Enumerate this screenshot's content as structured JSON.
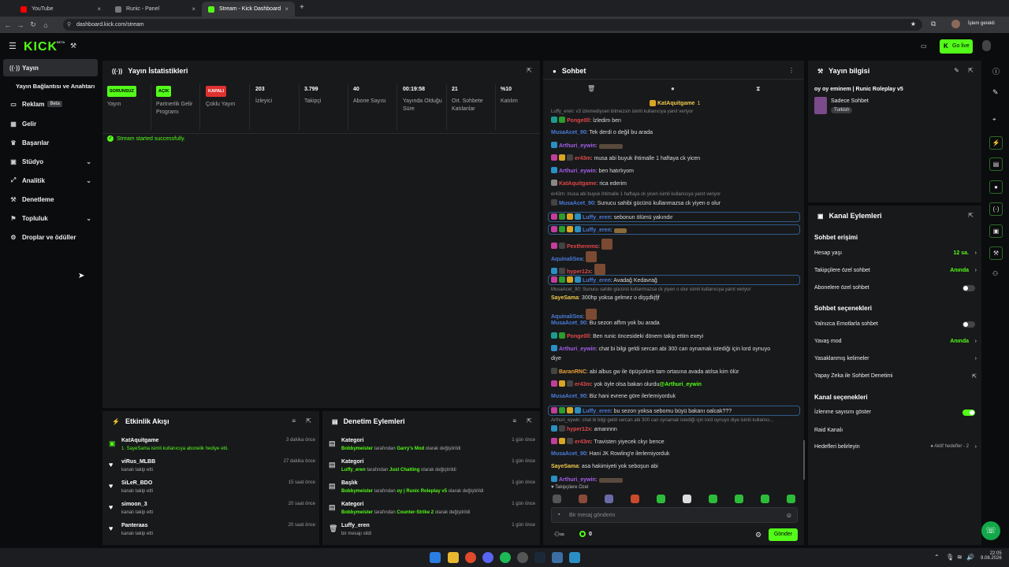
{
  "browser": {
    "tabs": [
      {
        "title": "YouTube",
        "color": "#ff0000"
      },
      {
        "title": "Runic - Panel",
        "color": "#888888"
      },
      {
        "title": "Stream - Kick Dashboard",
        "color": "#53fc18"
      }
    ],
    "new_tab": "+",
    "url": "dashboard.kick.com/stream",
    "profile_label": "İşlem gerekli"
  },
  "header": {
    "logo": "KICK",
    "logo_badge": "BETA",
    "go_live": "Go live"
  },
  "sidebar": [
    {
      "label": "Yayın",
      "icon": "((·))"
    },
    {
      "label": "Yayın Bağlantısı ve Anahtarı",
      "icon": ""
    },
    {
      "label": "Reklam",
      "icon": "▭",
      "badge": "Beta"
    },
    {
      "label": "Gelir",
      "icon": "▦"
    },
    {
      "label": "Başarılar",
      "icon": "♛"
    },
    {
      "label": "Stüdyo",
      "icon": "▣",
      "chevron": "⌄"
    },
    {
      "label": "Analitik",
      "icon": "⤢",
      "chevron": "⌄"
    },
    {
      "label": "Denetleme",
      "icon": "⚒"
    },
    {
      "label": "Topluluk",
      "icon": "⚑",
      "chevron": "⌄"
    },
    {
      "label": "Droplar ve ödüller",
      "icon": "⚙"
    }
  ],
  "stats": {
    "title": "Yayın İstatistikleri",
    "items": [
      {
        "tag": "SORUNSUZ",
        "tag_color": "#53fc18",
        "label": "Yayın"
      },
      {
        "tag": "AÇIK",
        "tag_color": "#53fc18",
        "label": "Partnerlik Gelir Programı"
      },
      {
        "tag": "KAPALI",
        "tag_color": "#e03131",
        "label": "Çoklu Yayın"
      },
      {
        "value": "203",
        "label": "İzleyici"
      },
      {
        "value": "3.799",
        "label": "Takipçi"
      },
      {
        "value": "40",
        "label": "Abone Sayısı"
      },
      {
        "value": "00:19:58",
        "label": "Yayında Olduğu Süre"
      },
      {
        "value": "21",
        "label": "Ort. Sohbete Katılanlar"
      },
      {
        "value": "%10",
        "label": "Katılım"
      }
    ],
    "success_msg": "Stream started successfully."
  },
  "activity": {
    "title": "Etkinlik Akışı",
    "items": [
      {
        "name": "KatAquitgame",
        "sub": "1. SayeSama isimli kullanıcıya abonelik hediye etti.",
        "time": "3 dakika önce",
        "icon": "▣"
      },
      {
        "name": "viRus_MLBB",
        "sub": "kanalı takip etti",
        "time": "27 dakika önce",
        "icon": "♥"
      },
      {
        "name": "SiLeR_BDO",
        "sub": "kanalı takip etti",
        "time": "15 saat önce",
        "icon": "♥"
      },
      {
        "name": "simoon_3",
        "sub": "kanalı takip etti",
        "time": "20 saat önce",
        "icon": "♥"
      },
      {
        "name": "Panteraas",
        "sub": "kanalı takip etti",
        "time": "20 saat önce",
        "icon": "♥"
      }
    ]
  },
  "moderation": {
    "title": "Denetim Eylemleri",
    "items": [
      {
        "name": "Kategori",
        "user": "Bobbymeister",
        "mid": " tarafından ",
        "obj": "Garry's Mod",
        "end": " olarak değiştirildi",
        "time": "1 gün önce",
        "icon": "▤"
      },
      {
        "name": "Kategori",
        "user": "Luffy_eren",
        "mid": " tarafından ",
        "obj": "Just Chatting",
        "end": " olarak değiştirildi",
        "time": "1 gün önce",
        "icon": "▤"
      },
      {
        "name": "Başlık",
        "user": "Bobbymeister",
        "mid": " tarafından ",
        "obj": "oy | Runic Roleplay v5",
        "end": " olarak değiştirildi",
        "time": "1 gün önce",
        "icon": "▤"
      },
      {
        "name": "Kategori",
        "user": "Bobbymeister",
        "mid": " tarafından ",
        "obj": "Counter-Strike 2",
        "end": " olarak değiştirildi",
        "time": "1 gün önce",
        "icon": "▤"
      },
      {
        "name": "Luffy_eren",
        "user": "",
        "mid": "",
        "obj": "",
        "end": "bir mesajı sildi",
        "time": "1 gün önce",
        "icon": "🗑"
      }
    ]
  },
  "chat": {
    "title": "Sohbet",
    "pinned_user": "KatAquitgame",
    "pinned_count": "1",
    "messages": [
      {
        "type": "reply",
        "text": "Luffy_eren: v3 izlemediysen bilmezsin isimli kullanıcıya yanıt veriyor"
      },
      {
        "user": "Ponge0ll",
        "color": "#e04848",
        "badges": [
          "#1e9b8f",
          "#2d9b2d"
        ],
        "text": ": İzledim ben"
      },
      {
        "user": "MusaAcet_90",
        "color": "#4a7bd8",
        "badges": [],
        "text": ": Tek derdi o değil bu arada"
      },
      {
        "user": "Arthuri_eywin",
        "color": "#a45fe8",
        "badges": [
          "#2a8fc2"
        ],
        "text": ":",
        "emote": "wide"
      },
      {
        "user": "er43m",
        "color": "#e04848",
        "badges": [
          "#c13f9b",
          "#d8a623",
          "#444444"
        ],
        "text": ": musa abi buyuk ihtimalle 1 haftaya ck yicen"
      },
      {
        "user": "Arthuri_eywin",
        "color": "#a45fe8",
        "badges": [
          "#2a8fc2"
        ],
        "text": ": ben hatırlıyom"
      },
      {
        "user": "KatAquitgame",
        "color": "#e04848",
        "badges": [
          "#888888"
        ],
        "text": ": rica ederim"
      },
      {
        "type": "reply",
        "text": "er43m: musa abi buyuk ihtimalle 1 haftaya ck yicen isimli kullanıcıya yanıt veriyor"
      },
      {
        "user": "MusaAcet_90",
        "color": "#4a7bd8",
        "badges": [
          "#444444"
        ],
        "text": ": Sunucu sahibi gücünü kullanmazsa ck yiyen o olur"
      },
      {
        "user": "Luffy_eren",
        "color": "#4a7bd8",
        "badges": [
          "#c13f9b",
          "#2d9b2d",
          "#d8a623",
          "#2a8fc2"
        ],
        "text": ": sebonun ölümü yakındır",
        "hl": true
      },
      {
        "user": "Luffy_eren",
        "color": "#4a7bd8",
        "badges": [
          "#c13f9b",
          "#2d9b2d",
          "#d8a623",
          "#2a8fc2"
        ],
        "text": ":",
        "emote": "small",
        "hl": true
      },
      {
        "user": "Pextheremo",
        "color": "#e04848",
        "badges": [
          "#c13f9b",
          "#444444"
        ],
        "text": ":",
        "emote": "emote"
      },
      {
        "user": "AquinaliSea",
        "color": "#4a7bd8",
        "badges": [],
        "text": ":",
        "emote": "emote"
      },
      {
        "user": "hyper12x",
        "color": "#e04848",
        "badges": [
          "#2a8fc2",
          "#444444"
        ],
        "text": ":",
        "emote": "emote"
      },
      {
        "user": "Luffy_eren",
        "color": "#4a7bd8",
        "badges": [
          "#c13f9b",
          "#2d9b2d",
          "#d8a623",
          "#2a8fc2"
        ],
        "text": ": Avadağ Kedavrağ",
        "hl": true
      },
      {
        "type": "reply",
        "text": "MusaAcet_90: Sunucu sahibi gücünü kullanmazsa ck yiyen o olur isimli kullanıcıya yanıt veriyor"
      },
      {
        "user": "SayeSama",
        "color": "#f2c94c",
        "badges": [],
        "text": ": 300hp yoksa gelmez o dişşdkjfjf"
      },
      {
        "user": "AquinaliSea",
        "color": "#4a7bd8",
        "badges": [],
        "text": ":",
        "emote": "emote"
      },
      {
        "user": "MusaAcet_90",
        "color": "#4a7bd8",
        "badges": [],
        "text": ": Bu sezon affım yok bu arada"
      },
      {
        "user": "Ponge0ll",
        "color": "#e04848",
        "badges": [
          "#1e9b8f",
          "#2d9b2d"
        ],
        "text": ": Ben runic öncesideki dönem takip ettim exeyi"
      },
      {
        "user": "Arthuri_eywin",
        "color": "#a45fe8",
        "badges": [
          "#2a8fc2"
        ],
        "text": ": chat bi bilgi geldi sercan abi 300 can oynamak istediği için lord oynuyo"
      },
      {
        "type": "cont",
        "text": "diye"
      },
      {
        "user": "BaranRNC",
        "color": "#e8a23a",
        "badges": [
          "#444444"
        ],
        "text": ": abi albus gw ile öpüşürken tam ortasına avada atılsa kim ölür"
      },
      {
        "user": "er43m",
        "color": "#e04848",
        "badges": [
          "#c13f9b",
          "#d8a623",
          "#444444"
        ],
        "text": ": yok öyle olsa bakan olurdu",
        "mention": "@Arthuri_eywin"
      },
      {
        "user": "MusaAcet_90",
        "color": "#4a7bd8",
        "badges": [],
        "text": ": Biz hani evrene göre ilerlemiyorduk"
      },
      {
        "user": "Luffy_eren",
        "color": "#4a7bd8",
        "badges": [
          "#c13f9b",
          "#2d9b2d",
          "#d8a623",
          "#2a8fc2"
        ],
        "text": ": bu sezon yoksa sebomu büyü bakanı oalcak???",
        "hl": true
      },
      {
        "type": "reply",
        "text": "Arthuri_eywin: chat bi bilgi geldi sercan abi 300 can oynamak istediği için lord oynuyo diye isimli kullanıcı..."
      },
      {
        "user": "hyper12x",
        "color": "#e04848",
        "badges": [
          "#2a8fc2",
          "#444444"
        ],
        "text": ": amannnn"
      },
      {
        "user": "er43m",
        "color": "#e04848",
        "badges": [
          "#c13f9b",
          "#d8a623",
          "#444444"
        ],
        "text": ": Travisten yiyecek ckyı bence"
      },
      {
        "user": "MusaAcet_90",
        "color": "#4a7bd8",
        "badges": [],
        "text": ": Hani JK Rowling'e ilerlemiyorduk"
      },
      {
        "user": "SayeSama",
        "color": "#f2c94c",
        "badges": [],
        "text": ": asa hakimiyeti yok seboşun abi"
      },
      {
        "user": "Arthuri_eywin",
        "color": "#a45fe8",
        "badges": [
          "#2a8fc2"
        ],
        "text": ":",
        "emote": "wide"
      }
    ],
    "followers_label": "Takipçilere Özel",
    "input_placeholder": "Bir mesaj gönderin",
    "viewer_count": "0",
    "send_label": "Gönder"
  },
  "stream_info": {
    "title": "Yayın bilgisi",
    "stream_title": "oy oy eminem | Runic Roleplay v5",
    "category": "Sadece Sohbet",
    "language": "Turkish"
  },
  "channel": {
    "title": "Kanal Eylemleri",
    "sections": [
      {
        "heading": "Sohbet erişimi"
      },
      {
        "label": "Hesap yaşı",
        "value": "12 sa.",
        "arrow": "›"
      },
      {
        "label": "Takipçilere özel sohbet",
        "value": "Anında",
        "arrow": "›"
      },
      {
        "label": "Abonelere özel sohbet",
        "toggle": false
      },
      {
        "heading": "Sohbet seçenekleri"
      },
      {
        "label": "Yalnızca Emotlarla sohbet",
        "toggle": false
      },
      {
        "label": "Yavaş mod",
        "value": "Anında",
        "arrow": "›"
      },
      {
        "label": "Yasaklanmış kelimeler",
        "arrow": "›"
      },
      {
        "label": "Yapay Zeka ile Sohbet Denetimi",
        "arrow": "⇱"
      },
      {
        "heading": "Kanal seçenekleri"
      },
      {
        "label": "İzlenme sayısını göster",
        "toggle": true
      },
      {
        "label": "Raid Kanalı"
      },
      {
        "label": "Hedefleri belirleyin",
        "note": "● Aktif hedefler - 2",
        "arrow": "›"
      }
    ]
  },
  "taskbar": {
    "time": "22:05",
    "date": "9.08.2026"
  },
  "colors": {
    "accent": "#53fc18",
    "panel": "#18191b",
    "bg": "#0b0c0d"
  }
}
